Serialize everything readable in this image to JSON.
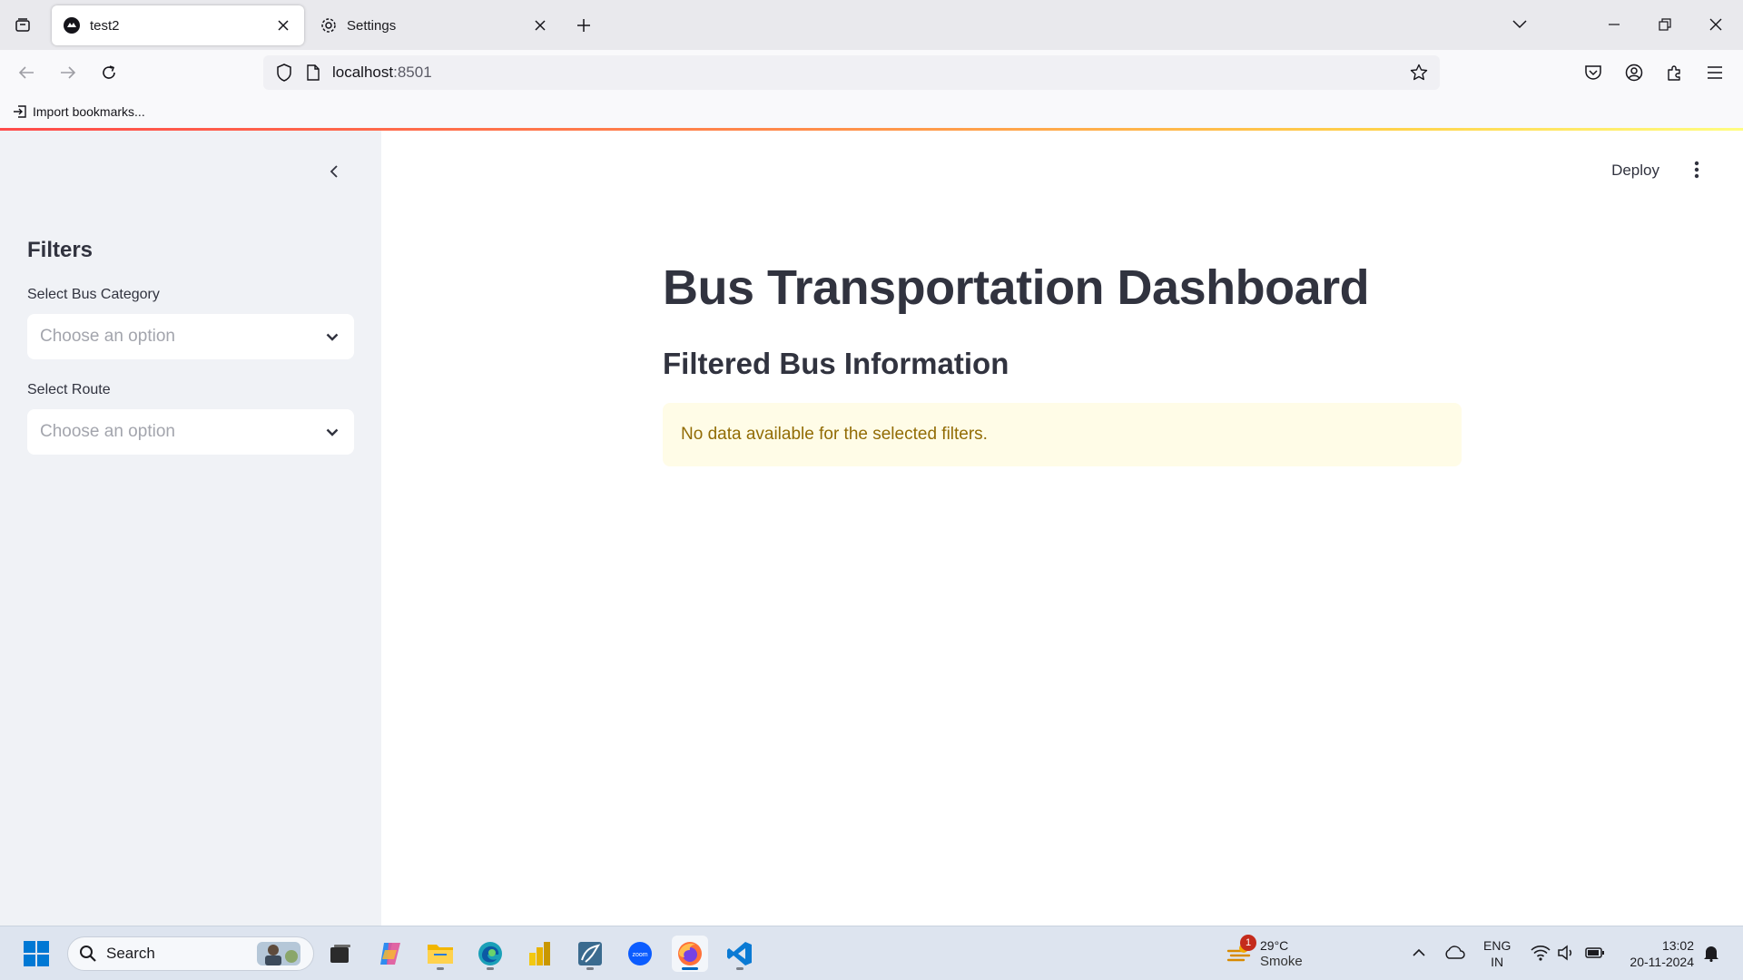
{
  "browser": {
    "tabs": [
      {
        "title": "test2",
        "active": true
      },
      {
        "title": "Settings",
        "active": false
      }
    ],
    "url_host": "localhost",
    "url_port": ":8501",
    "bookmarks": [
      {
        "label": "Import bookmarks..."
      }
    ]
  },
  "app": {
    "header": {
      "deploy_label": "Deploy"
    },
    "sidebar": {
      "heading": "Filters",
      "filters": [
        {
          "label": "Select Bus Category",
          "placeholder": "Choose an option"
        },
        {
          "label": "Select Route",
          "placeholder": "Choose an option"
        }
      ]
    },
    "main": {
      "title": "Bus Transportation Dashboard",
      "subtitle": "Filtered Bus Information",
      "alert": "No data available for the selected filters."
    },
    "colors": {
      "accent": "#ff4b4b",
      "alert_bg": "#fffce7",
      "alert_text": "#926c05",
      "sidebar_bg": "#f0f2f6"
    }
  },
  "taskbar": {
    "search_label": "Search",
    "weather": {
      "temp": "29°C",
      "desc": "Smoke",
      "badge": "1"
    },
    "language": {
      "line1": "ENG",
      "line2": "IN"
    },
    "clock": {
      "time": "13:02",
      "date": "20-11-2024"
    },
    "pinned_apps": [
      "task-view",
      "copilot",
      "file-explorer",
      "edge",
      "power-bi",
      "mysql-workbench",
      "zoom",
      "firefox",
      "vscode"
    ]
  }
}
